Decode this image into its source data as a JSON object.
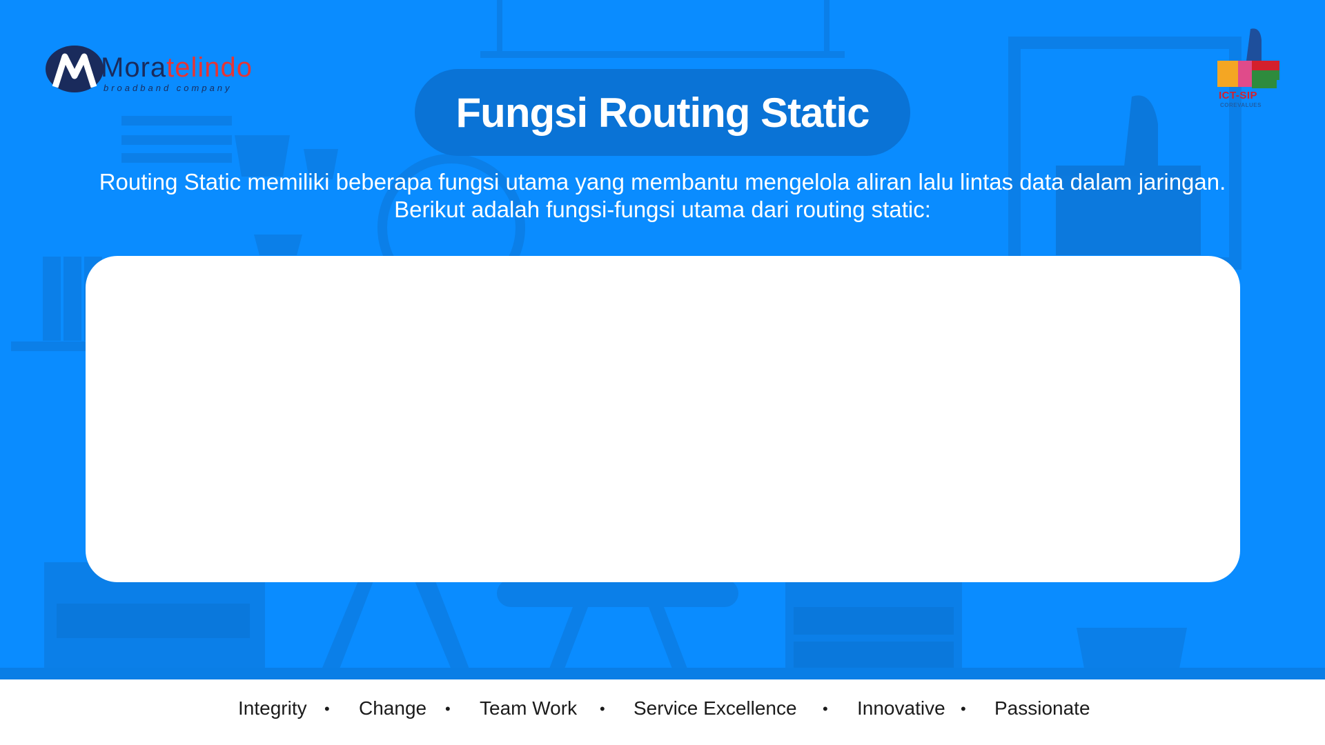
{
  "brand": {
    "name_part1": "Mora",
    "name_part2": "telindo",
    "tagline": "broadband company"
  },
  "corevalues_badge": {
    "title": "ICT-SIP",
    "subtitle": "COREVALUES"
  },
  "slide": {
    "title": "Fungsi Routing Static",
    "intro_line1": "Routing Static memiliki beberapa fungsi utama yang membantu mengelola aliran lalu lintas data dalam jaringan.",
    "intro_line2": "Berikut adalah fungsi-fungsi utama dari routing static:"
  },
  "footer": {
    "values": [
      "Integrity",
      "Change",
      "Team Work",
      "Service Excellence",
      "Innovative",
      "Passionate"
    ],
    "separator": "•"
  },
  "colors": {
    "background": "#0a8cff",
    "title_pill": "#0a73d6",
    "brand_navy": "#1a2b5c",
    "brand_red": "#e53535"
  }
}
